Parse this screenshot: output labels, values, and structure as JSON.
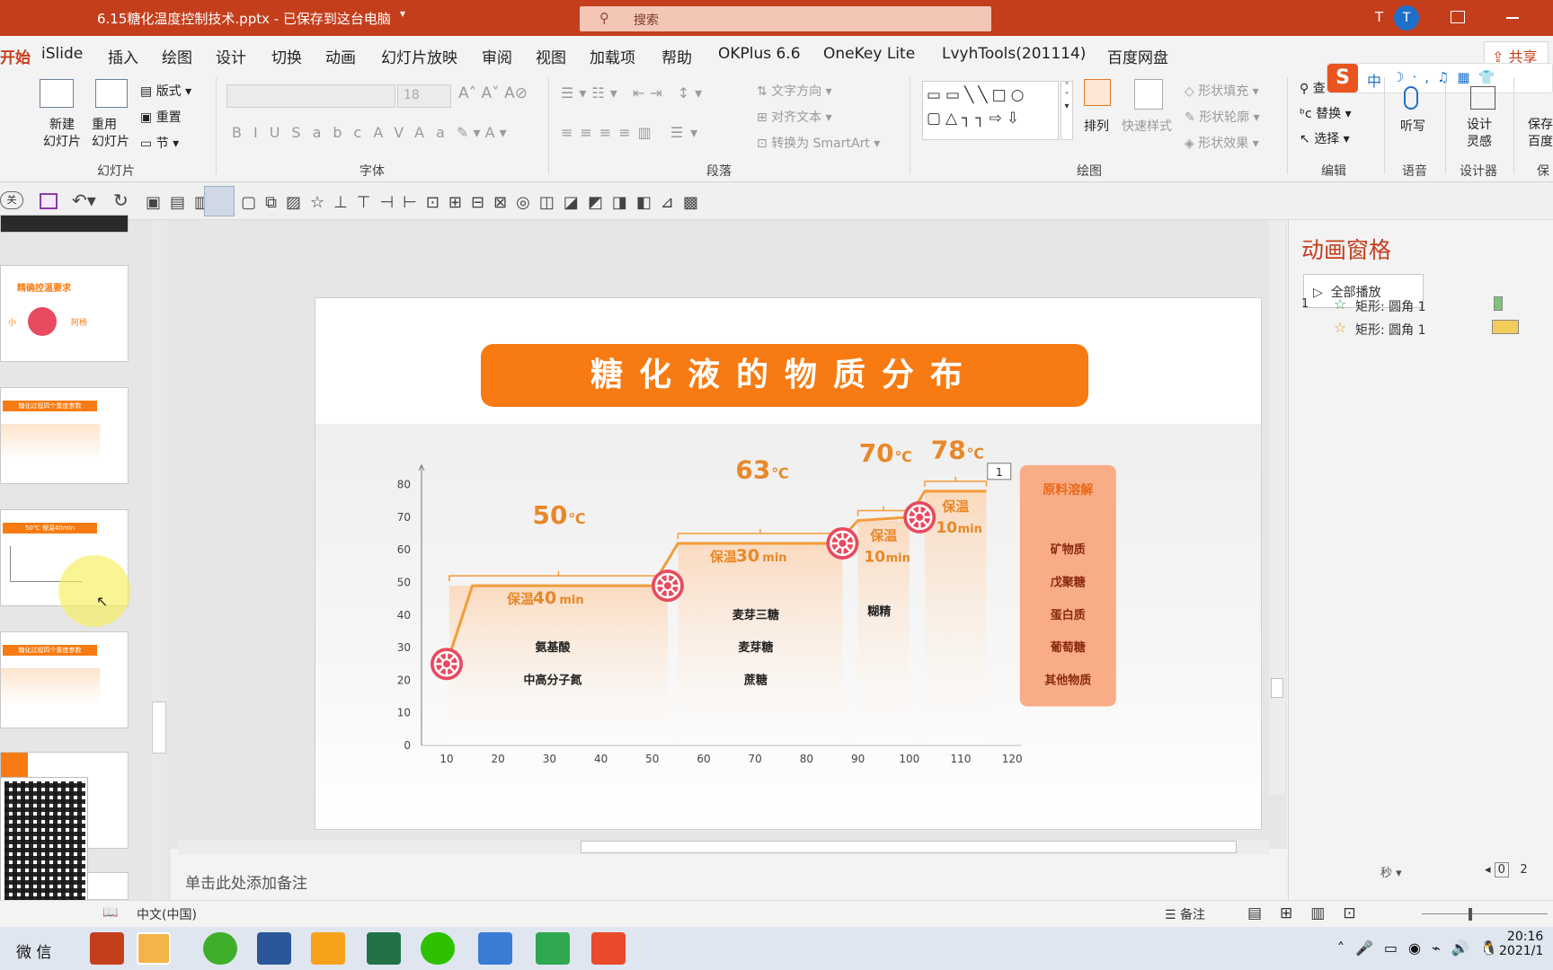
{
  "window": {
    "title": "6.15糖化温度控制技术.pptx - 已保存到这台电脑",
    "search_placeholder": "搜索",
    "user_initial": "T"
  },
  "menu": {
    "items": [
      "开始",
      "iSlide",
      "插入",
      "绘图",
      "设计",
      "切换",
      "动画",
      "幻灯片放映",
      "审阅",
      "视图",
      "加载项",
      "帮助",
      "OKPlus 6.6",
      "OneKey Lite",
      "LvyhTools(201114)",
      "百度网盘"
    ],
    "share": "共享"
  },
  "ribbon": {
    "slides": {
      "new_slide": "新建\n幻灯片",
      "reuse": "重用\n幻灯片",
      "layout": "版式",
      "reset": "重置",
      "section": "节",
      "label": "幻灯片"
    },
    "font": {
      "size": "18",
      "label": "字体"
    },
    "paragraph": {
      "text_dir": "文字方向",
      "align_text": "对齐文本",
      "smartart": "转换为 SmartArt",
      "label": "段落"
    },
    "drawing": {
      "arrange": "排列",
      "quick_styles": "快速样式",
      "fill": "形状填充",
      "outline": "形状轮廓",
      "effects": "形状效果",
      "label": "绘图"
    },
    "editing": {
      "find": "查",
      "replace": "替换",
      "select": "选择",
      "label": "编辑"
    },
    "voice": {
      "dictate": "听写",
      "label": "语音"
    },
    "designer": {
      "design": "设计\n灵感",
      "label": "设计器"
    },
    "save": {
      "label": "保存\n百度",
      "group": "保"
    }
  },
  "slide": {
    "title": "糖化液的物质分布",
    "chart_data": {
      "type": "line",
      "x_ticks": [
        10,
        20,
        30,
        40,
        50,
        60,
        70,
        80,
        90,
        100,
        110,
        120
      ],
      "y_ticks": [
        0,
        10,
        20,
        30,
        40,
        50,
        60,
        70,
        80
      ],
      "series": [
        {
          "name": "",
          "points": [
            [
              10,
              25
            ],
            [
              15,
              49
            ],
            [
              50,
              49
            ],
            [
              55,
              62
            ],
            [
              86,
              62
            ],
            [
              90,
              69
            ],
            [
              100,
              70
            ],
            [
              103,
              78
            ],
            [
              115,
              78
            ]
          ]
        }
      ],
      "stages": [
        {
          "temp": "50",
          "unit": "℃",
          "hold_label": "保温",
          "hold_time": "40",
          "hold_unit": "min",
          "items": [
            "氨基酸",
            "中高分子氮"
          ]
        },
        {
          "temp": "63",
          "unit": "℃",
          "hold_label": "保温",
          "hold_time": "30",
          "hold_unit": "min",
          "items": [
            "麦芽三糖",
            "麦芽糖",
            "蔗糖"
          ]
        },
        {
          "temp": "70",
          "unit": "℃",
          "hold_label": "保温",
          "hold_time": "10",
          "hold_unit": "min",
          "items": [
            "糊精"
          ]
        },
        {
          "temp": "78",
          "unit": "℃",
          "hold_label": "保温",
          "hold_time": "10",
          "hold_unit": "min",
          "items": []
        }
      ],
      "box": {
        "title": "原料溶解",
        "items": [
          "矿物质",
          "戊聚糖",
          "蛋白质",
          "葡萄糖",
          "其他物质"
        ]
      },
      "marker_tag": "1"
    }
  },
  "thumbs": {
    "t1_title": "精确控温要求",
    "t1_a": "小",
    "t1_b": "阿杨",
    "t2_title": "糖化过程四个重度参数",
    "t3_title": "50℃ 保温40min"
  },
  "notes": {
    "placeholder": "单击此处添加备注"
  },
  "anim_pane": {
    "title": "动画窗格",
    "play_all": "全部播放",
    "items": [
      {
        "num": "1",
        "label": "矩形: 圆角 1"
      },
      {
        "num": "",
        "label": "矩形: 圆角 1"
      }
    ],
    "time_unit": "秒",
    "time_start": "0",
    "time_end": "2"
  },
  "status": {
    "language": "中文(中国)",
    "notes_btn": "备注"
  },
  "taskbar": {
    "clock_time": "20:16",
    "clock_date": "2021/1",
    "sogou": "中"
  },
  "colors": {
    "accent": "#c43e1c",
    "orange": "#f77b12",
    "chart_line": "#f39c3a"
  }
}
